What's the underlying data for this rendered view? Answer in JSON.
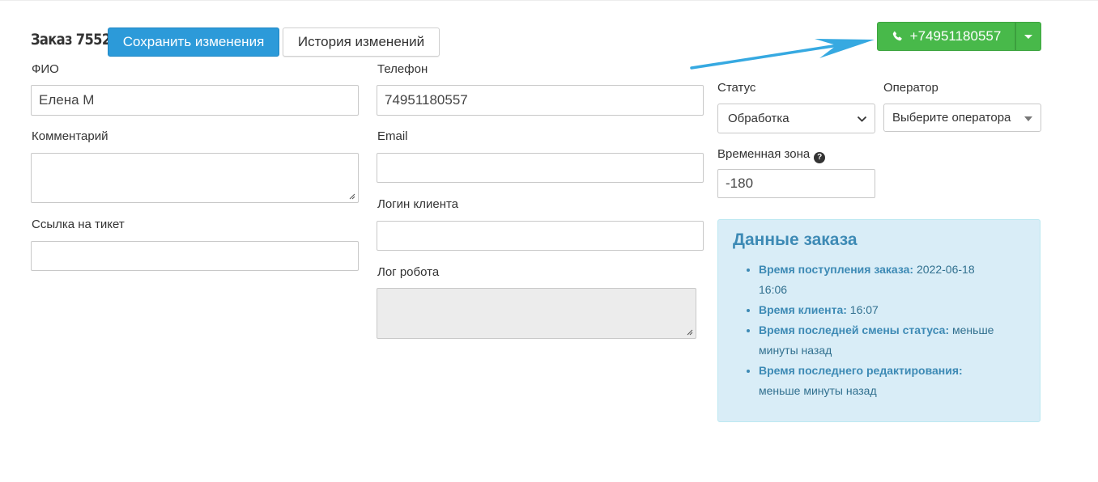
{
  "header": {
    "order_title": "Заказ 7552",
    "save_label": "Сохранить изменения",
    "history_label": "История изменений",
    "call_number": "+74951180557"
  },
  "form": {
    "fio_label": "ФИО",
    "fio_value": "Елена М",
    "comment_label": "Комментарий",
    "ticket_label": "Ссылка на тикет",
    "phone_label": "Телефон",
    "phone_value": "74951180557",
    "email_label": "Email",
    "login_label": "Логин клиента",
    "robot_log_label": "Лог робота",
    "status_label": "Статус",
    "status_value": "Обработка",
    "operator_label": "Оператор",
    "operator_value": "Выберите оператора",
    "timezone_label": "Временная зона",
    "timezone_value": "-180"
  },
  "order_info": {
    "title": "Данные заказа",
    "items": [
      {
        "label": "Время поступления заказа:",
        "value": "2022-06-18 16:06"
      },
      {
        "label": "Время клиента:",
        "value": "16:07"
      },
      {
        "label": "Время последней смены статуса:",
        "value": "меньше минуты назад"
      },
      {
        "label": "Время последнего редактирования:",
        "value": "меньше минуты назад"
      }
    ]
  },
  "colors": {
    "save_button": "#2c9ad9",
    "call_button": "#48b94a",
    "info_panel_bg": "#d9edf7",
    "arrow": "#36a9e1"
  }
}
